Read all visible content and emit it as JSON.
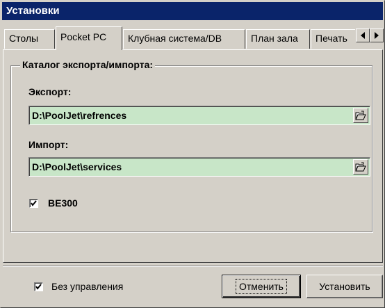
{
  "window": {
    "title": "Установки"
  },
  "tabs": [
    {
      "label": "Столы",
      "active": false
    },
    {
      "label": "Pocket PC",
      "active": true
    },
    {
      "label": "Клубная система/DB",
      "active": false
    },
    {
      "label": "План зала",
      "active": false
    },
    {
      "label": "Печать",
      "active": false
    }
  ],
  "tab_scroll": {
    "left_icon": "arrow-left-icon",
    "right_icon": "arrow-right-icon"
  },
  "group": {
    "title": "Каталог экспорта/импорта:",
    "export_label": "Экспорт:",
    "export_path": "D:\\PoolJet\\refrences",
    "import_label": "Импорт:",
    "import_path": "D:\\PoolJet\\services",
    "browse_icon": "folder-open-icon",
    "be300_label": "BE300",
    "be300_checked": true
  },
  "footer": {
    "no_control_label": "Без управления",
    "no_control_checked": true,
    "cancel_label": "Отменить",
    "apply_label": "Установить"
  },
  "colors": {
    "title_bar": "#0a246a",
    "field_bg": "#c8e6c8",
    "dialog_bg": "#d4d0c8"
  }
}
